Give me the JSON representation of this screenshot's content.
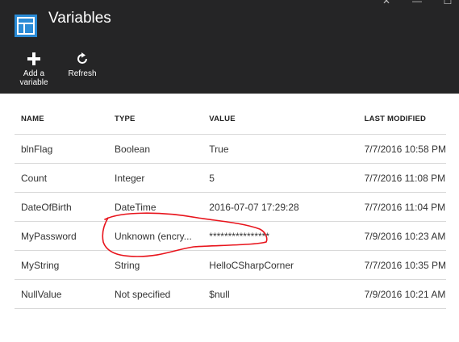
{
  "header": {
    "title": "Variables",
    "icon": "variables-blade-icon",
    "colors": {
      "background": "#252526",
      "icon_accent": "#2a8bd6"
    }
  },
  "commands": {
    "add_label": "Add a variable",
    "add_icon": "plus-icon",
    "refresh_label": "Refresh",
    "refresh_icon": "refresh-icon"
  },
  "table": {
    "headers": [
      "NAME",
      "TYPE",
      "VALUE",
      "LAST MODIFIED"
    ],
    "rows": [
      [
        "blnFlag",
        "Boolean",
        "True",
        "7/7/2016 10:58 PM"
      ],
      [
        "Count",
        "Integer",
        "5",
        "7/7/2016 11:08 PM"
      ],
      [
        "DateOfBirth",
        "DateTime",
        "2016-07-07 17:29:28",
        "7/7/2016 11:04 PM"
      ],
      [
        "MyPassword",
        "Unknown (encry...",
        "****************",
        "7/9/2016 10:23 AM"
      ],
      [
        "MyString",
        "String",
        "HelloCSharpCorner",
        "7/7/2016 10:35 PM"
      ],
      [
        "NullValue",
        "Not specified",
        "$null",
        "7/9/2016 10:21 AM"
      ]
    ]
  },
  "annotation": {
    "color": "#e8141c",
    "shape": "hand-drawn-circle"
  }
}
